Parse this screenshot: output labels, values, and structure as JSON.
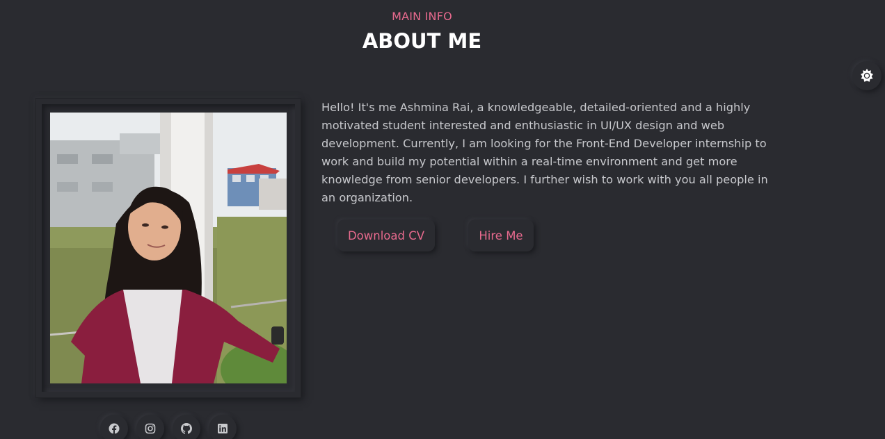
{
  "section": {
    "eyebrow": "MAIN INFO",
    "title": "ABOUT ME"
  },
  "about": {
    "bio": "Hello! It's me Ashmina Rai, a knowledgeable, detailed-oriented and a highly motivated student interested and enthusiastic in UI/UX design and web development. Currently, I am looking for the Front-End Developer internship to work and build my potential within a real-time environment and get more knowledge from senior developers. I further wish to work with you all people in an organization.",
    "download_cv": "Download CV",
    "hire_me": "Hire Me"
  },
  "icons": {
    "theme_toggle": "sun-icon",
    "social": [
      "facebook-icon",
      "instagram-icon",
      "github-icon",
      "linkedin-icon"
    ]
  },
  "colors": {
    "background": "#2a2b30",
    "accent": "#e86a8e",
    "heading": "#ffffff",
    "body_text": "#c7c8cc"
  }
}
